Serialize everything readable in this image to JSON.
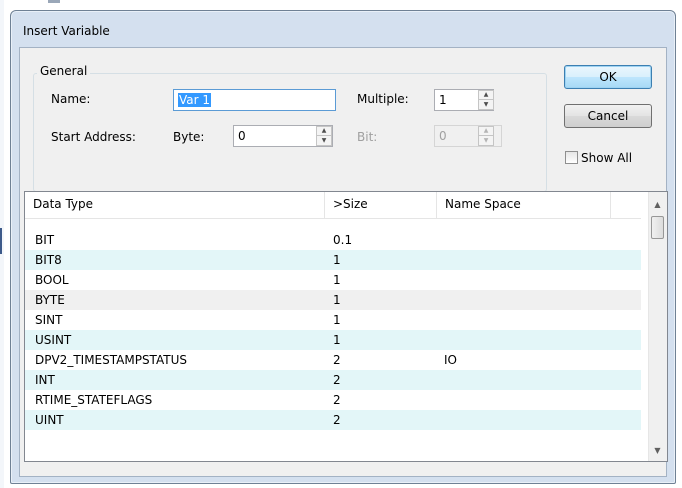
{
  "dialog": {
    "title": "Insert Variable",
    "general": {
      "legend": "General",
      "name_label": "Name:",
      "name_value": "Var 1",
      "multiple_label": "Multiple:",
      "multiple_value": "1",
      "start_address_label": "Start Address:",
      "byte_label": "Byte:",
      "byte_value": "0",
      "bit_label": "Bit:",
      "bit_value": "0"
    },
    "buttons": {
      "ok": "OK",
      "cancel": "Cancel"
    },
    "show_all": {
      "label": "Show All",
      "checked": false
    }
  },
  "list": {
    "columns": [
      "Data Type",
      ">Size",
      "Name Space"
    ],
    "rows": [
      {
        "type": "BIT",
        "size": "0.1",
        "ns": ""
      },
      {
        "type": "BIT8",
        "size": "1",
        "ns": ""
      },
      {
        "type": "BOOL",
        "size": "1",
        "ns": ""
      },
      {
        "type": "BYTE",
        "size": "1",
        "ns": ""
      },
      {
        "type": "SINT",
        "size": "1",
        "ns": ""
      },
      {
        "type": "USINT",
        "size": "1",
        "ns": ""
      },
      {
        "type": "DPV2_TIMESTAMPSTATUS",
        "size": "2",
        "ns": "IO"
      },
      {
        "type": "INT",
        "size": "2",
        "ns": ""
      },
      {
        "type": "RTIME_STATEFLAGS",
        "size": "2",
        "ns": ""
      },
      {
        "type": "UINT",
        "size": "2",
        "ns": ""
      }
    ]
  },
  "icons": {
    "spin_up": "up-arrow-icon",
    "spin_down": "down-arrow-icon",
    "scroll_up": "scroll-up-icon",
    "scroll_down": "scroll-down-icon"
  }
}
